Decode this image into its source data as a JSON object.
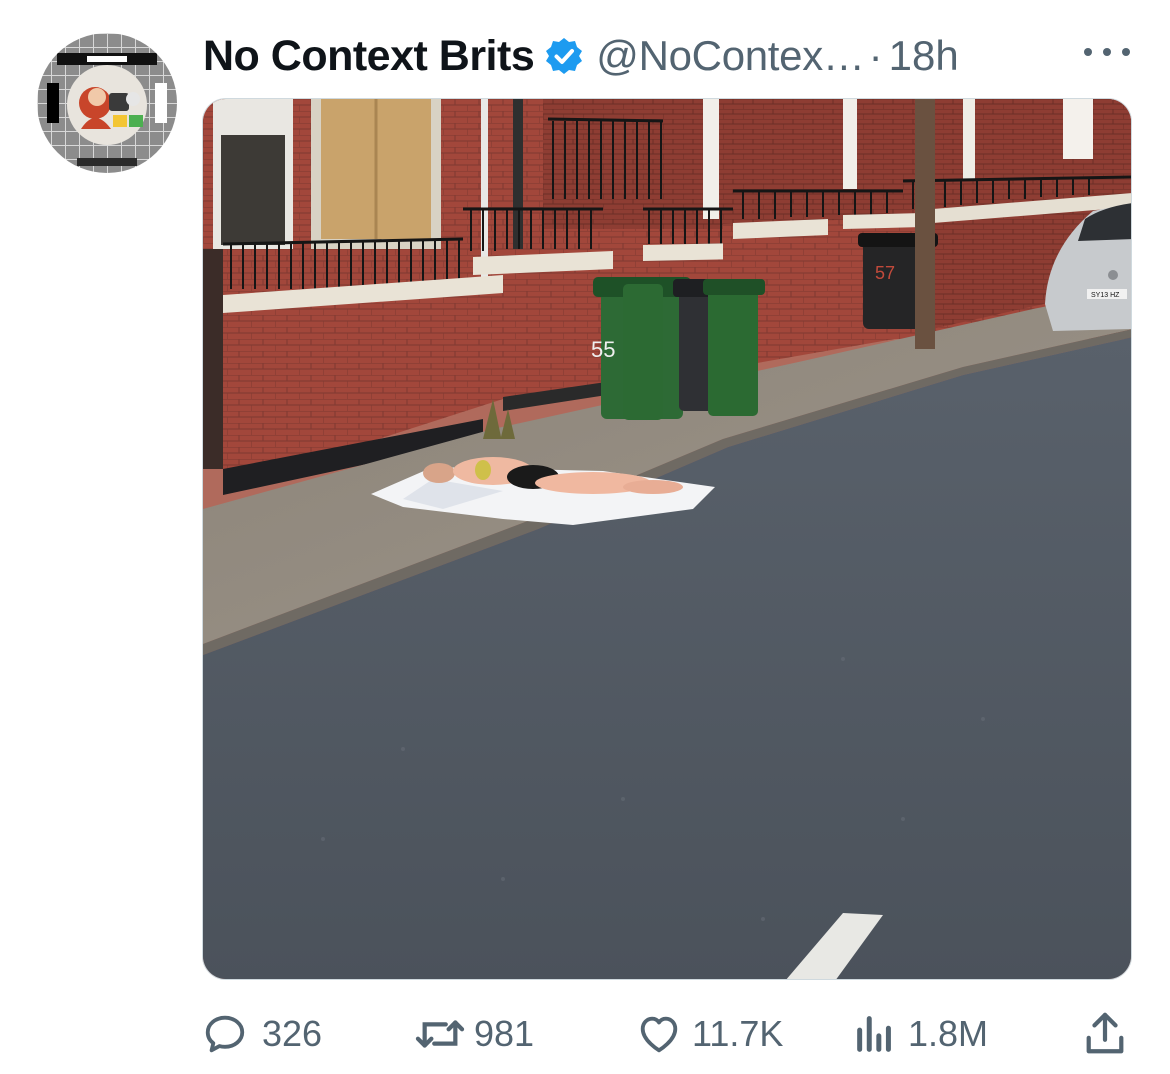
{
  "tweet": {
    "display_name": "No Context Brits",
    "handle": "@NoContex…",
    "separator": "·",
    "time": "18h",
    "verified": true
  },
  "media": {
    "bin_numbers": [
      "55",
      "57"
    ],
    "car_plate": "SY13 HZ"
  },
  "actions": {
    "replies": "326",
    "reposts": "981",
    "likes": "11.7K",
    "views": "1.8M"
  },
  "icons": {
    "verified": "verified-badge-icon",
    "more": "more-options-icon",
    "reply": "reply-icon",
    "repost": "repost-icon",
    "like": "heart-icon",
    "views": "views-chart-icon",
    "share": "share-icon"
  },
  "colors": {
    "verified_blue": "#1d9bf0",
    "secondary_text": "#536471",
    "primary_text": "#0f1419"
  }
}
